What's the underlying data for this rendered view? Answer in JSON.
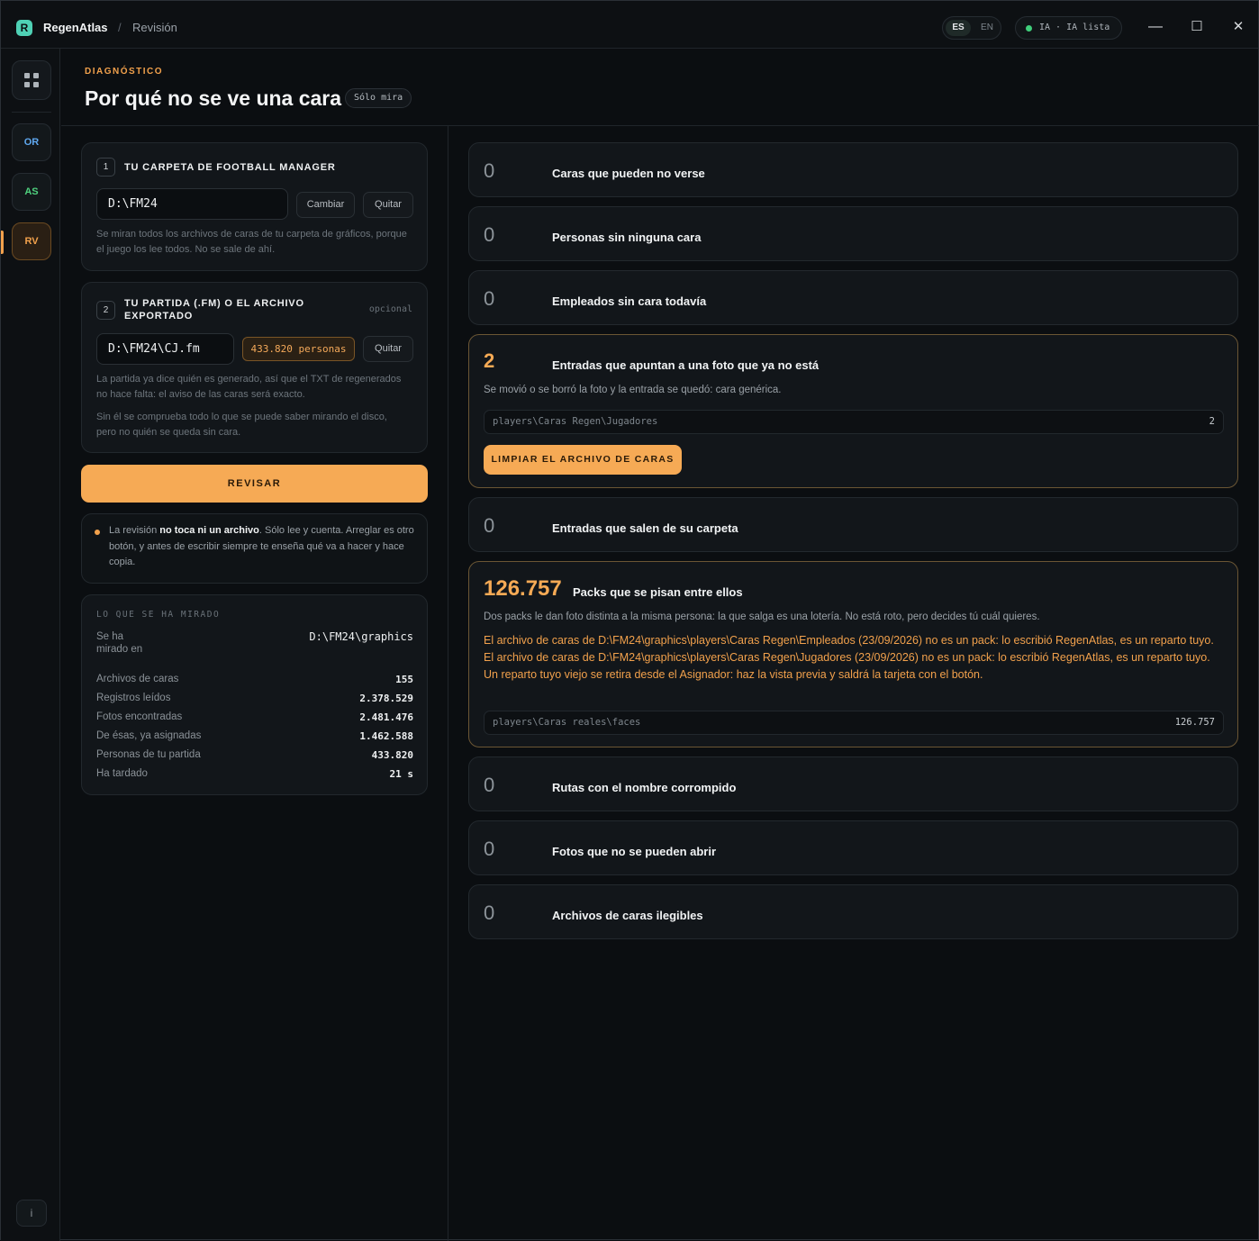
{
  "titlebar": {
    "logo_letter": "R",
    "app_name": "RegenAtlas",
    "separator": "/",
    "crumb": "Revisión",
    "lang_es": "ES",
    "lang_en": "EN",
    "ia_status": "IA · IA lista",
    "minimize": "—",
    "maximize": "☐",
    "close": "✕"
  },
  "sidebar": {
    "items": [
      {
        "label": "OR",
        "color": "#5fa8f0"
      },
      {
        "label": "AS",
        "color": "#4fd17e"
      },
      {
        "label": "RV",
        "color": "#f2a14c"
      }
    ],
    "info": "i"
  },
  "header": {
    "eyebrow": "DIAGNÓSTICO",
    "title": "Por qué no se ve una cara",
    "badge": "Sólo mira"
  },
  "folder_card": {
    "step": "1",
    "heading": "TU CARPETA DE FOOTBALL MANAGER",
    "path": "D:\\FM24",
    "change": "Cambiar",
    "remove": "Quitar",
    "help": "Se miran todos los archivos de caras de tu carpeta de gráficos, porque el juego los lee todos. No se sale de ahí."
  },
  "save_card": {
    "step": "2",
    "heading_line1": "TU PARTIDA (.FM) O EL ARCHIVO",
    "heading_line2": "EXPORTADO",
    "optional": "opcional",
    "path": "D:\\FM24\\CJ.fm",
    "people": "433.820 personas",
    "remove": "Quitar",
    "help1": "La partida ya dice quién es generado, así que el TXT de regenerados no hace falta: el aviso de las caras será exacto.",
    "help2": "Sin él se comprueba todo lo que se puede saber mirando el disco, pero no quién se queda sin cara."
  },
  "review_button": "REVISAR",
  "note": {
    "pre": "La revisión ",
    "bold": "no toca ni un archivo",
    "post": ". Sólo lee y cuenta. Arreglar es otro botón, y antes de escribir siempre te enseña qué va a hacer y hace copia."
  },
  "stats": {
    "heading": "LO QUE SE HA MIRADO",
    "rows": [
      {
        "k": "Se ha mirado en",
        "v": "D:\\FM24\\graphics"
      },
      {
        "k": "Archivos de caras",
        "v": "155"
      },
      {
        "k": "Registros leídos",
        "v": "2.378.529"
      },
      {
        "k": "Fotos encontradas",
        "v": "2.481.476"
      },
      {
        "k": "De ésas, ya asignadas",
        "v": "1.462.588"
      },
      {
        "k": "Personas de tu partida",
        "v": "433.820"
      },
      {
        "k": "Ha tardado",
        "v": "21 s"
      }
    ]
  },
  "checks": [
    {
      "num": "0",
      "title": "Caras que pueden no verse"
    },
    {
      "num": "0",
      "title": "Personas sin ninguna cara"
    },
    {
      "num": "0",
      "title": "Empleados sin cara todavía"
    },
    {
      "num": "2",
      "title": "Entradas que apuntan a una foto que ya no está",
      "desc": "Se movió o se borró la foto y la entrada se quedó: cara genérica.",
      "path": "players\\Caras Regen\\Jugadores",
      "count": "2",
      "action": "LIMPIAR EL ARCHIVO DE CARAS"
    },
    {
      "num": "0",
      "title": "Entradas que salen de su carpeta"
    },
    {
      "num": "126.757",
      "title": "Packs que se pisan entre ellos",
      "desc": "Dos packs le dan foto distinta a la misma persona: la que salga es una lotería. No está roto, pero decides tú cuál quieres.",
      "detail": "El archivo de caras de D:\\FM24\\graphics\\players\\Caras Regen\\Empleados (23/09/2026) no es un pack: lo escribió RegenAtlas, es un reparto tuyo. El archivo de caras de D:\\FM24\\graphics\\players\\Caras Regen\\Jugadores (23/09/2026) no es un pack: lo escribió RegenAtlas, es un reparto tuyo. Un reparto tuyo viejo se retira desde el Asignador: haz la vista previa y saldrá la tarjeta con el botón.",
      "path": "players\\Caras reales\\faces",
      "count": "126.757"
    },
    {
      "num": "0",
      "title": "Rutas con el nombre corrompido"
    },
    {
      "num": "0",
      "title": "Fotos que no se pueden abrir"
    },
    {
      "num": "0",
      "title": "Archivos de caras ilegibles"
    }
  ]
}
